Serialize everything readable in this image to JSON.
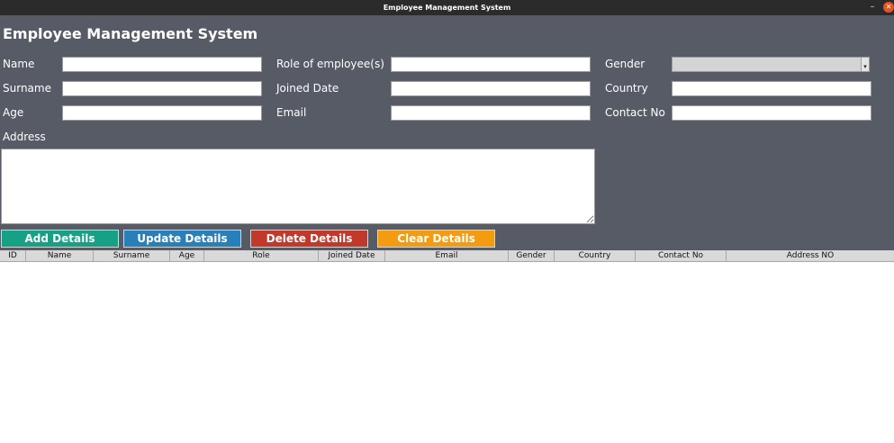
{
  "window": {
    "title": "Employee Management System"
  },
  "form": {
    "heading": "Employee Management System",
    "labels": {
      "name": "Name",
      "surname": "Surname",
      "age": "Age",
      "role": "Role of employee(s)",
      "joined_date": "Joined Date",
      "email": "Email",
      "gender": "Gender",
      "country": "Country",
      "contact_no": "Contact No",
      "address": "Address"
    },
    "values": {
      "name": "",
      "surname": "",
      "age": "",
      "role": "",
      "joined_date": "",
      "email": "",
      "gender": "",
      "country": "",
      "contact_no": "",
      "address": ""
    }
  },
  "buttons": {
    "add": {
      "label": "Add Details",
      "color": "#16a085"
    },
    "update": {
      "label": "Update Details",
      "color": "#2980b9"
    },
    "delete": {
      "label": "Delete Details",
      "color": "#c0392b"
    },
    "clear": {
      "label": "Clear Details",
      "color": "#f39c12"
    }
  },
  "table": {
    "columns": [
      "ID",
      "Name",
      "Surname",
      "Age",
      "Role",
      "Joined Date",
      "Email",
      "Gender",
      "Country",
      "Contact No",
      "Address NO"
    ],
    "rows": []
  }
}
